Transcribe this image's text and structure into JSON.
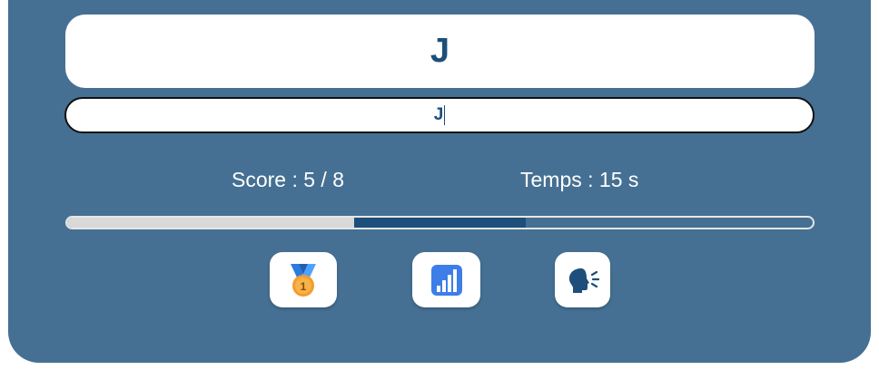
{
  "prompt": {
    "letter": "J"
  },
  "answer": {
    "value": "J"
  },
  "stats": {
    "score_label": "Score : 5 / 8",
    "time_label": "Temps : 15 s"
  },
  "progress": {
    "done_fraction": 0.385,
    "current_fraction": 0.23,
    "colors": {
      "done": "#d9d9d9",
      "current": "#1d4f7a"
    }
  },
  "buttons": [
    {
      "icon": "medal-icon"
    },
    {
      "icon": "bar-chart-icon"
    },
    {
      "icon": "speaking-head-icon"
    }
  ],
  "colors": {
    "background": "#457093",
    "accent": "#1d4f7a",
    "card": "#ffffff"
  }
}
